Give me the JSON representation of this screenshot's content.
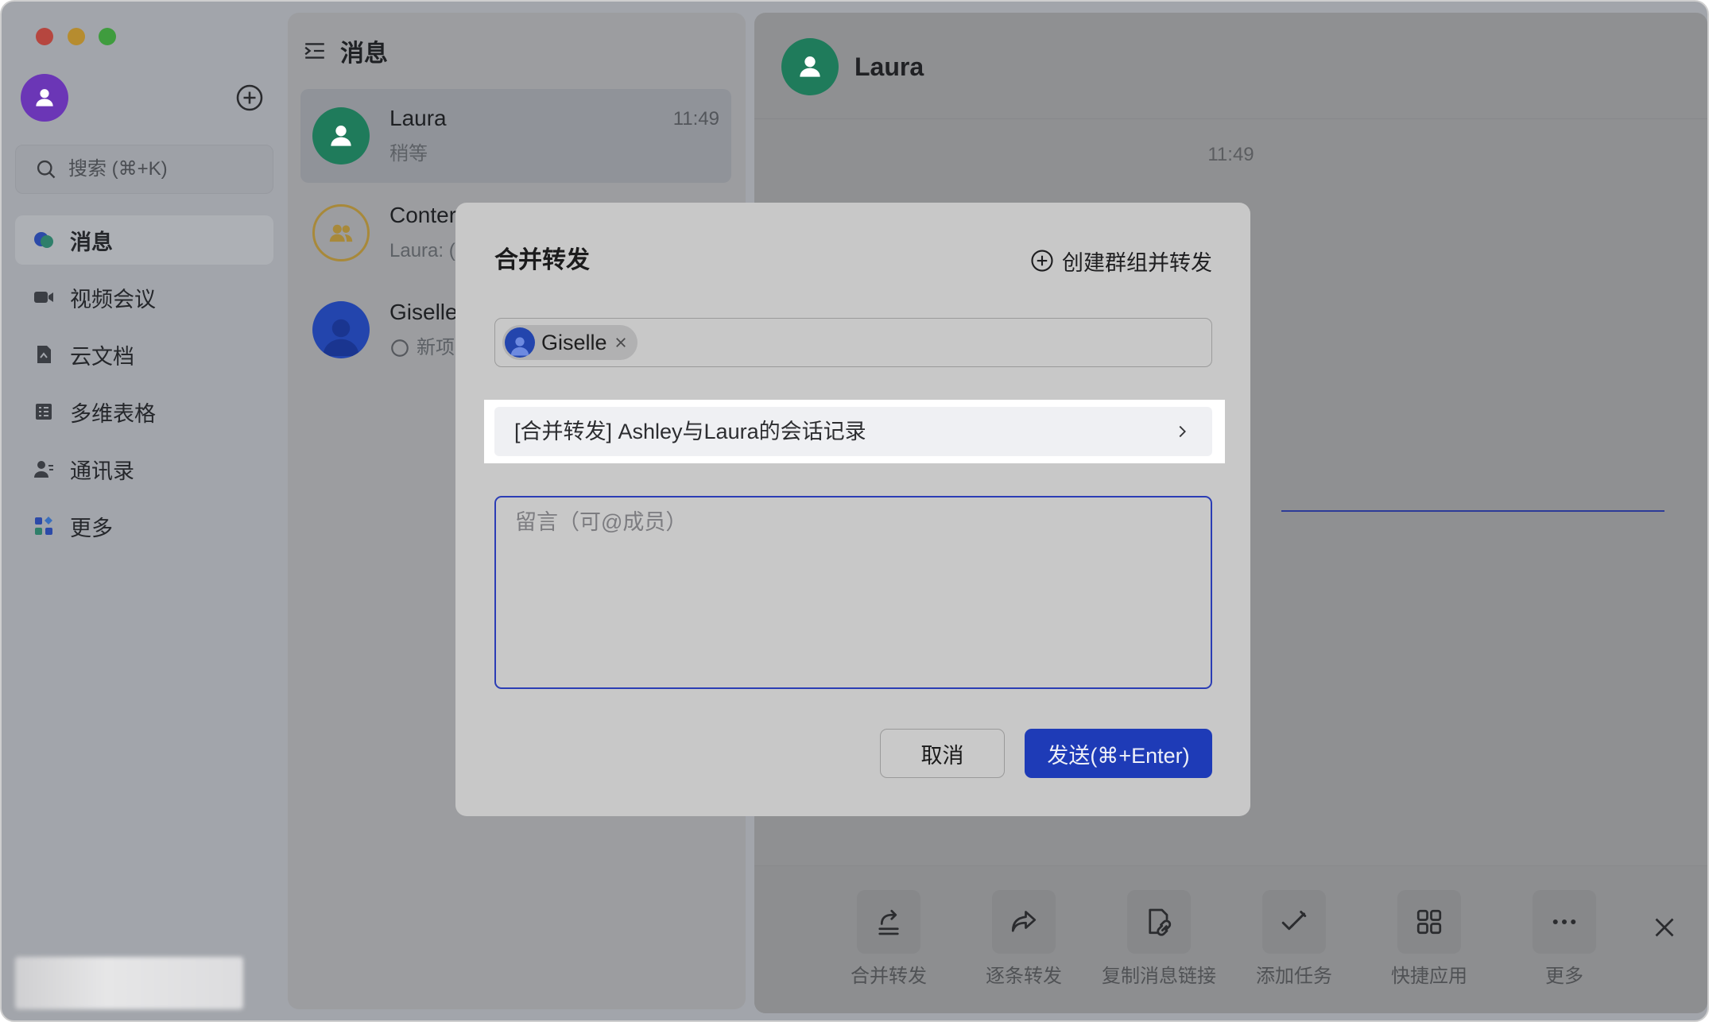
{
  "colors": {
    "accent": "#1e3bb7",
    "focus_border": "#2b3db5",
    "highlight": "#ffffff",
    "avatar_self": "#6b36b6",
    "avatar_laura": "#1f7b5b",
    "avatar_giselle": "#2345ad",
    "avatar_group": "#a8893a",
    "traffic_red": "#b6463f",
    "traffic_yellow": "#b68c2f",
    "traffic_green": "#3f9c3e"
  },
  "sidebar": {
    "avatar_icon": "person-icon",
    "new_icon": "plus-circle-icon",
    "search": {
      "icon": "search-icon",
      "placeholder": "搜索 (⌘+K)"
    },
    "nav": [
      {
        "label": "消息",
        "icon": "message-icon",
        "selected": true
      },
      {
        "label": "视频会议",
        "icon": "video-icon",
        "selected": false
      },
      {
        "label": "云文档",
        "icon": "docs-icon",
        "selected": false
      },
      {
        "label": "多维表格",
        "icon": "table-icon",
        "selected": false
      },
      {
        "label": "通讯录",
        "icon": "contacts-icon",
        "selected": false
      },
      {
        "label": "更多",
        "icon": "more-apps-icon",
        "selected": false
      }
    ]
  },
  "chat_list": {
    "title": "消息",
    "icon": "list-indent-icon",
    "items": [
      {
        "name": "Laura",
        "time": "11:49",
        "preview": "稍等",
        "selected": true
      },
      {
        "name": "Conter",
        "preview": "Laura: (",
        "selected": false
      },
      {
        "name": "Giselle",
        "preview": "新项",
        "selected": false
      }
    ]
  },
  "chat": {
    "title": "Laura",
    "timestamp": "11:49",
    "toolbar": [
      {
        "label": "合并转发",
        "icon": "merge-forward-icon"
      },
      {
        "label": "逐条转发",
        "icon": "forward-icon"
      },
      {
        "label": "复制消息链接",
        "icon": "copy-link-icon"
      },
      {
        "label": "添加任务",
        "icon": "add-task-icon"
      },
      {
        "label": "快捷应用",
        "icon": "quick-apps-icon"
      },
      {
        "label": "更多",
        "icon": "more-icon"
      }
    ],
    "close_icon": "close-icon"
  },
  "dialog": {
    "title": "合并转发",
    "create_group_label": "创建群组并转发",
    "recipients": [
      {
        "name": "Giselle"
      }
    ],
    "forward_item": "[合并转发] Ashley与Laura的会话记录",
    "message_placeholder": "留言（可@成员）",
    "cancel_label": "取消",
    "send_label": "发送(⌘+Enter)"
  }
}
